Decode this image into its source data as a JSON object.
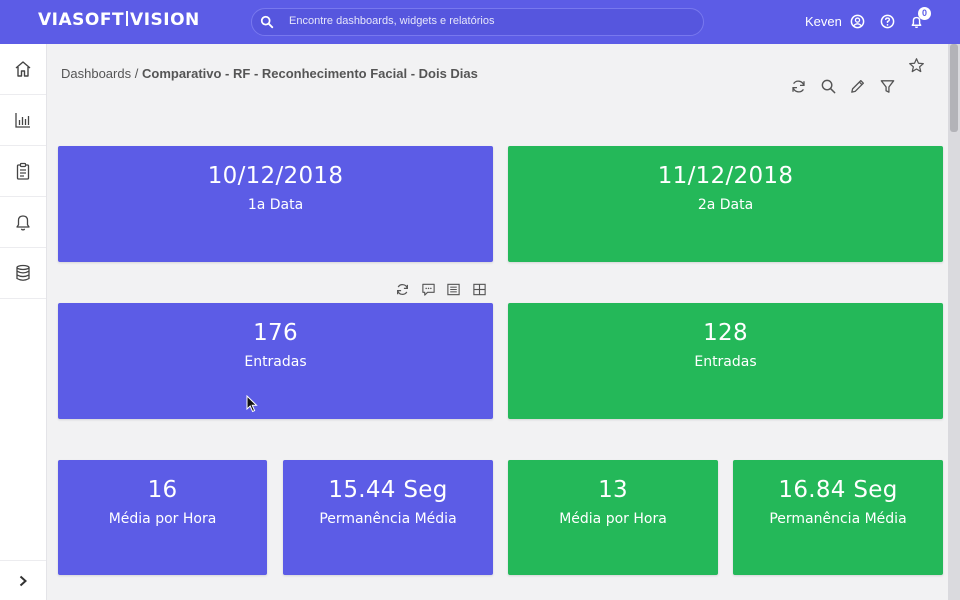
{
  "brand": {
    "logo_left": "VIASOFT",
    "logo_right": "VISION"
  },
  "search": {
    "placeholder": "Encontre dashboards, widgets e relatórios"
  },
  "user": {
    "name": "Keven"
  },
  "notifications": {
    "count": "0"
  },
  "breadcrumb": {
    "root": "Dashboards",
    "separator": "/",
    "current": "Comparativo - RF - Reconhecimento Facial - Dois Dias"
  },
  "icons": {
    "sidebar": [
      "home-icon",
      "chart-icon",
      "clipboard-icon",
      "bell-icon",
      "database-icon"
    ],
    "header": [
      "refresh-icon",
      "search-icon",
      "edit-icon",
      "filter-icon",
      "star-icon"
    ],
    "widget_tools": [
      "refresh-icon",
      "comment-icon",
      "list-icon",
      "table-icon"
    ]
  },
  "colors": {
    "primary": "#5c5ce6",
    "success": "#24b859"
  },
  "cards": {
    "date1": {
      "value": "10/12/2018",
      "label": "1a Data"
    },
    "date2": {
      "value": "11/12/2018",
      "label": "2a Data"
    },
    "entries1": {
      "value": "176",
      "label": "Entradas"
    },
    "entries2": {
      "value": "128",
      "label": "Entradas"
    },
    "avg_hour1": {
      "value": "16",
      "label": "Média por Hora"
    },
    "stay1": {
      "value": "15.44 Seg",
      "label": "Permanência Média"
    },
    "avg_hour2": {
      "value": "13",
      "label": "Média por Hora"
    },
    "stay2": {
      "value": "16.84 Seg",
      "label": "Permanência Média"
    }
  }
}
